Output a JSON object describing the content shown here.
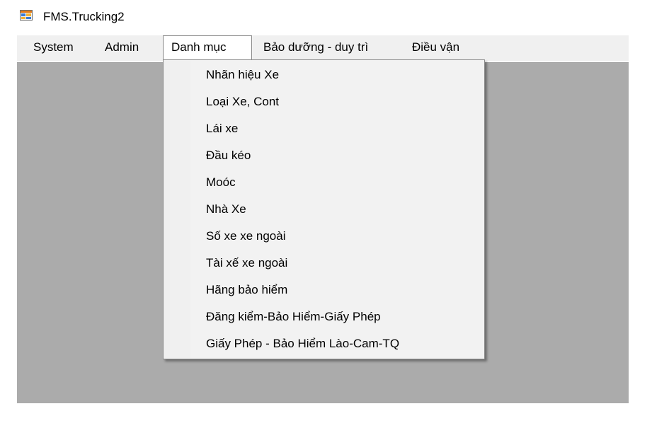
{
  "window": {
    "title": "FMS.Trucking2",
    "icon": "app-window-icon"
  },
  "menubar": {
    "items": [
      {
        "label": "System"
      },
      {
        "label": "Admin"
      },
      {
        "label": "Danh mục"
      },
      {
        "label": "Bảo dưỡng - duy trì"
      },
      {
        "label": "Điều vận"
      }
    ],
    "open_index": 2
  },
  "dropdown": {
    "items": [
      {
        "label": "Nhãn hiệu Xe"
      },
      {
        "label": "Loại Xe, Cont"
      },
      {
        "label": "Lái xe"
      },
      {
        "label": "Đầu kéo"
      },
      {
        "label": "Moóc"
      },
      {
        "label": "Nhà Xe"
      },
      {
        "label": "Số xe xe ngoài"
      },
      {
        "label": "Tài xế xe ngoài"
      },
      {
        "label": "Hãng bảo hiểm"
      },
      {
        "label": "Đăng kiểm-Bảo Hiểm-Giấy Phép"
      },
      {
        "label": "Giấy Phép - Bảo Hiểm Lào-Cam-TQ"
      }
    ]
  },
  "colors": {
    "menubar_bg": "#f0f0f0",
    "client_bg": "#ababab",
    "dropdown_bg": "#f2f2f2"
  }
}
